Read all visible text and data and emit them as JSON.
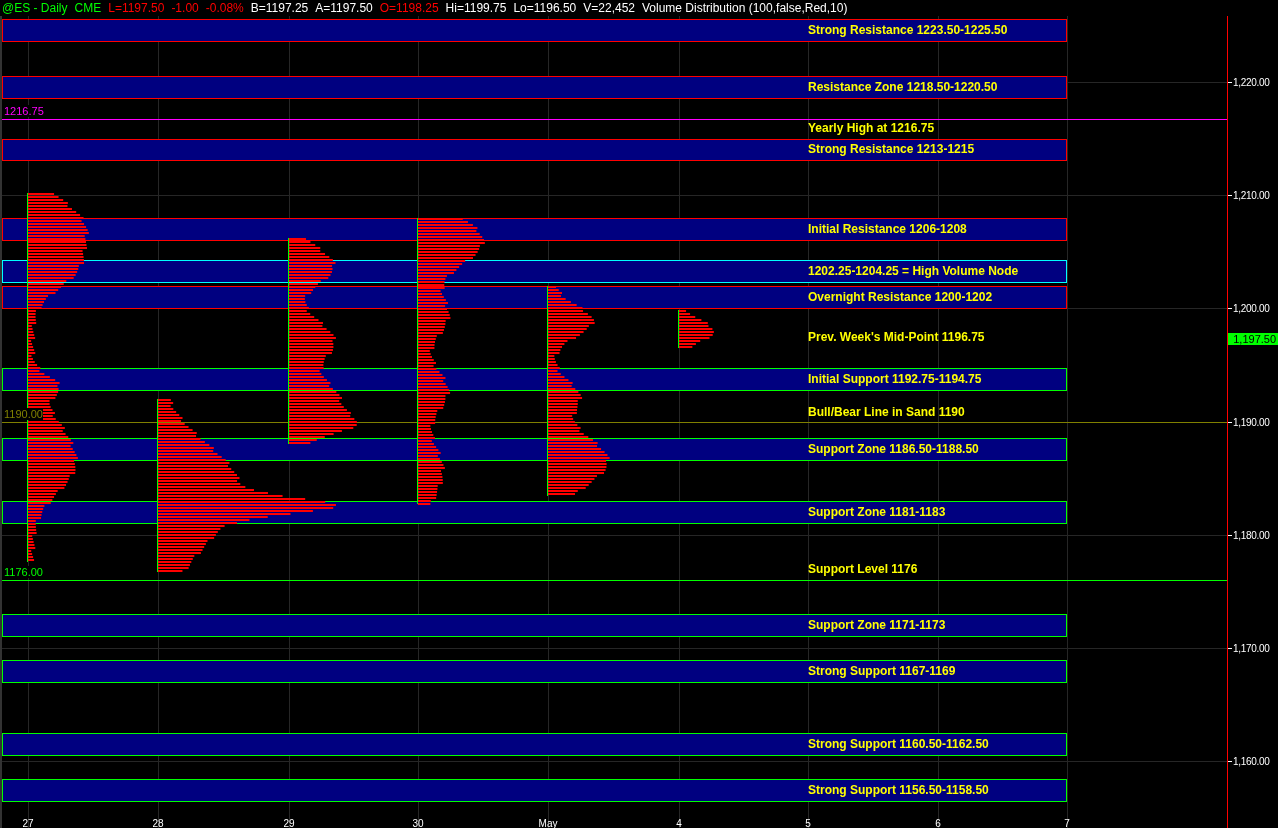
{
  "header": [
    {
      "text": "@ES - Daily",
      "kind": "symbol"
    },
    {
      "text": "CME",
      "kind": "symbol"
    },
    {
      "text": "L=1197.50",
      "kind": "down"
    },
    {
      "text": "-1.00",
      "kind": "down"
    },
    {
      "text": "-0.08%",
      "kind": "down"
    },
    {
      "text": "B=1197.25",
      "kind": "plain"
    },
    {
      "text": "A=1197.50",
      "kind": "plain"
    },
    {
      "text": "O=1198.25",
      "kind": "down"
    },
    {
      "text": "Hi=1199.75",
      "kind": "plain"
    },
    {
      "text": "Lo=1196.50",
      "kind": "plain"
    },
    {
      "text": "V=22,452",
      "kind": "plain"
    },
    {
      "text": "Volume Distribution (100,false,Red,10)",
      "kind": "plain"
    }
  ],
  "levels": [
    {
      "kind": "zone",
      "label": "Strong Resistance 1223.50-1225.50",
      "color": "#ff0000"
    },
    {
      "kind": "zone",
      "label": "Resistance Zone 1218.50-1220.50",
      "color": "#ff0000"
    },
    {
      "kind": "line",
      "label": "Yearly High at 1216.75",
      "color": "#ff00ff",
      "price_label": "1216.75"
    },
    {
      "kind": "zone",
      "label": "Strong Resistance 1213-1215",
      "color": "#ff0000"
    },
    {
      "kind": "zone",
      "label": "Initial Resistance 1206-1208",
      "color": "#ff0000"
    },
    {
      "kind": "zone",
      "label": "1202.25-1204.25 = High Volume Node",
      "color": "#00ffff"
    },
    {
      "kind": "zone",
      "label": "Overnight Resistance 1200-1202",
      "color": "#ff0000"
    },
    {
      "kind": "note",
      "label": "Prev. Week's Mid-Point 1196.75"
    },
    {
      "kind": "zone",
      "label": "Initial Support 1192.75-1194.75",
      "color": "#00ff00"
    },
    {
      "kind": "line",
      "label": "Bull/Bear Line in Sand 1190",
      "color": "#808000",
      "price_label": "1190.00"
    },
    {
      "kind": "zone",
      "label": "Support Zone 1186.50-1188.50",
      "color": "#00ff00"
    },
    {
      "kind": "zone",
      "label": "Support Zone 1181-1183",
      "color": "#00ff00"
    },
    {
      "kind": "line",
      "label": "Support Level 1176",
      "color": "#00ff00",
      "price_label": "1176.00"
    },
    {
      "kind": "zone",
      "label": "Support Zone 1171-1173",
      "color": "#00ff00"
    },
    {
      "kind": "zone",
      "label": "Strong Support 1167-1169",
      "color": "#00ff00"
    },
    {
      "kind": "zone",
      "label": "Strong Support 1160.50-1162.50",
      "color": "#00ff00"
    },
    {
      "kind": "zone",
      "label": "Strong Support 1156.50-1158.50",
      "color": "#00ff00"
    }
  ],
  "price_axis": [
    "1,220.00",
    "1,210.00",
    "1,200.00",
    "1,190.00",
    "1,180.00",
    "1,170.00",
    "1,160.00"
  ],
  "last_price": "1,197.50",
  "date_axis": [
    "27",
    "28",
    "29",
    "30",
    "May",
    "4",
    "5",
    "6",
    "7"
  ]
}
